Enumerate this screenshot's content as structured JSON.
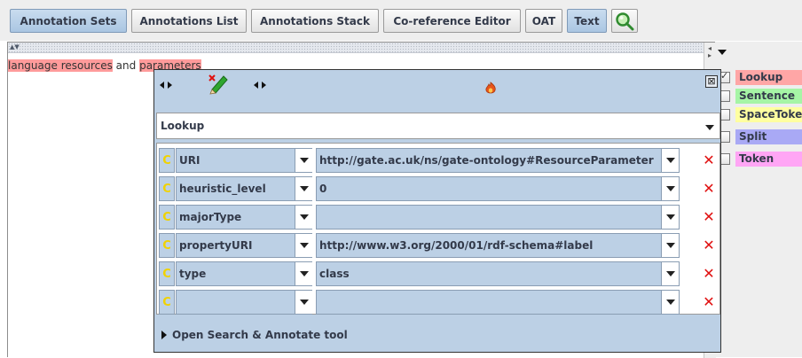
{
  "toolbar": {
    "buttons": [
      {
        "label": "Annotation Sets",
        "active": true
      },
      {
        "label": "Annotations List",
        "active": false
      },
      {
        "label": "Annotations Stack",
        "active": false
      },
      {
        "label": "Co-reference Editor",
        "active": false
      },
      {
        "label": "OAT",
        "active": false
      },
      {
        "label": "Text",
        "active": true
      }
    ],
    "search_icon": "magnifier-icon"
  },
  "document": {
    "words": [
      {
        "text": "language",
        "highlighted": true
      },
      {
        "text": " ",
        "highlighted": true
      },
      {
        "text": "resources",
        "highlighted": true
      },
      {
        "text": " and ",
        "highlighted": false
      },
      {
        "text": "parameters",
        "highlighted": true
      }
    ],
    "highlight_color": "#ff9b9b"
  },
  "legend": {
    "items": [
      {
        "label": "Lookup",
        "checked": true,
        "color": "#ffa6a6"
      },
      {
        "label": "Sentence",
        "checked": false,
        "color": "#a6f5a6"
      },
      {
        "label": "SpaceToken",
        "checked": false,
        "color": "#ffffa0"
      },
      {
        "label": "Split",
        "checked": false,
        "color": "#a9a9f5"
      },
      {
        "label": "Token",
        "checked": false,
        "color": "#ffa6f5"
      }
    ]
  },
  "editor": {
    "annotation_type": "Lookup",
    "features": [
      {
        "name": "URI",
        "value": "http://gate.ac.uk/ns/gate-ontology#ResourceParameter"
      },
      {
        "name": "heuristic_level",
        "value": "0"
      },
      {
        "name": "majorType",
        "value": ""
      },
      {
        "name": "propertyURI",
        "value": "http://www.w3.org/2000/01/rdf-schema#label"
      },
      {
        "name": "type",
        "value": "class"
      },
      {
        "name": "",
        "value": ""
      }
    ],
    "feature_icon_glyph": "C",
    "delete_glyph": "✕",
    "close_glyph": "⊠",
    "open_search_label": "Open Search & Annotate tool",
    "icons": [
      "pencil-delete-icon",
      "fire-icon"
    ],
    "colors": {
      "panel": "#bcd0e5",
      "delete": "#e01010",
      "feature_icon": "#f0d200"
    }
  }
}
